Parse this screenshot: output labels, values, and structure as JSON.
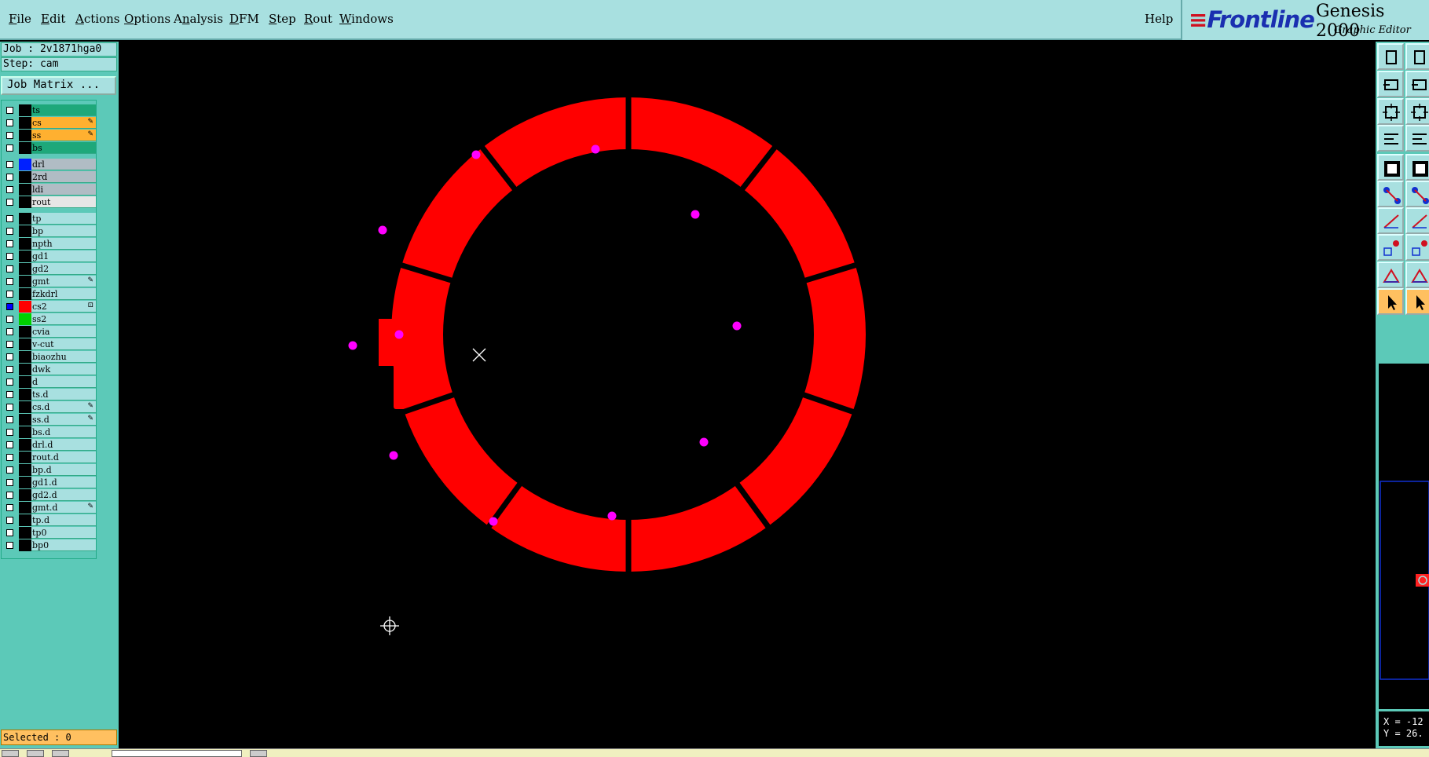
{
  "menu": {
    "items": [
      {
        "label": "File",
        "accel": "F"
      },
      {
        "label": "Edit",
        "accel": "E"
      },
      {
        "label": "Actions",
        "accel": "A"
      },
      {
        "label": "Options",
        "accel": "O"
      },
      {
        "label": "Analysis",
        "accel": "n"
      },
      {
        "label": "DFM",
        "accel": "D"
      },
      {
        "label": "Step",
        "accel": "S"
      },
      {
        "label": "Rout",
        "accel": "R"
      },
      {
        "label": "Windows",
        "accel": "W"
      }
    ],
    "help": "Help"
  },
  "brand": {
    "logo": "Frontline",
    "stripes": "≡",
    "title": "Genesis 2000",
    "subtitle": "Graphic Editor"
  },
  "job": {
    "job_text": "Job : 2v1871hga0",
    "step_text": "Step: cam",
    "matrix_button": "Job Matrix ..."
  },
  "layers": [
    {
      "name": "ts",
      "bg": "#1ea87a",
      "swatch": "#000",
      "mark": "",
      "checked": false
    },
    {
      "name": "cs",
      "bg": "#ffb030",
      "swatch": "#000",
      "mark": "✎",
      "checked": false
    },
    {
      "name": "ss",
      "bg": "#ffb030",
      "swatch": "#000",
      "mark": "✎",
      "checked": false
    },
    {
      "name": "bs",
      "bg": "#1ea87a",
      "swatch": "#000",
      "mark": "",
      "checked": false
    },
    {
      "name": "drl",
      "bg": "#b0bcc4",
      "swatch": "#0020ff",
      "mark": "",
      "checked": false
    },
    {
      "name": "2rd",
      "bg": "#b0bcc4",
      "swatch": "#000",
      "mark": "",
      "checked": false
    },
    {
      "name": "ldi",
      "bg": "#b0bcc4",
      "swatch": "#000",
      "mark": "",
      "checked": false
    },
    {
      "name": "rout",
      "bg": "#e6e6e6",
      "swatch": "#000",
      "mark": "",
      "checked": false
    },
    {
      "name": "tp",
      "bg": "#a8e0e0",
      "swatch": "#000",
      "mark": "",
      "checked": false
    },
    {
      "name": "bp",
      "bg": "#a8e0e0",
      "swatch": "#000",
      "mark": "",
      "checked": false
    },
    {
      "name": "npth",
      "bg": "#a8e0e0",
      "swatch": "#000",
      "mark": "",
      "checked": false
    },
    {
      "name": "gd1",
      "bg": "#a8e0e0",
      "swatch": "#000",
      "mark": "",
      "checked": false
    },
    {
      "name": "gd2",
      "bg": "#a8e0e0",
      "swatch": "#000",
      "mark": "",
      "checked": false
    },
    {
      "name": "gmt",
      "bg": "#a8e0e0",
      "swatch": "#000",
      "mark": "✎",
      "checked": false
    },
    {
      "name": "fzkdrl",
      "bg": "#a8e0e0",
      "swatch": "#000",
      "mark": "",
      "checked": false
    },
    {
      "name": "cs2",
      "bg": "#a8e0e0",
      "swatch": "#ff0000",
      "mark": "⊡",
      "checked": true
    },
    {
      "name": "ss2",
      "bg": "#a8e0e0",
      "swatch": "#00d000",
      "mark": "",
      "checked": false
    },
    {
      "name": "cvia",
      "bg": "#a8e0e0",
      "swatch": "#000",
      "mark": "",
      "checked": false
    },
    {
      "name": "v-cut",
      "bg": "#a8e0e0",
      "swatch": "#000",
      "mark": "",
      "checked": false
    },
    {
      "name": "biaozhu",
      "bg": "#a8e0e0",
      "swatch": "#000",
      "mark": "",
      "checked": false
    },
    {
      "name": "dwk",
      "bg": "#a8e0e0",
      "swatch": "#000",
      "mark": "",
      "checked": false
    },
    {
      "name": "d",
      "bg": "#a8e0e0",
      "swatch": "#000",
      "mark": "",
      "checked": false
    },
    {
      "name": "ts.d",
      "bg": "#a8e0e0",
      "swatch": "#000",
      "mark": "",
      "checked": false
    },
    {
      "name": "cs.d",
      "bg": "#a8e0e0",
      "swatch": "#000",
      "mark": "✎",
      "checked": false
    },
    {
      "name": "ss.d",
      "bg": "#a8e0e0",
      "swatch": "#000",
      "mark": "✎",
      "checked": false
    },
    {
      "name": "bs.d",
      "bg": "#a8e0e0",
      "swatch": "#000",
      "mark": "",
      "checked": false
    },
    {
      "name": "drl.d",
      "bg": "#a8e0e0",
      "swatch": "#000",
      "mark": "",
      "checked": false
    },
    {
      "name": "rout.d",
      "bg": "#a8e0e0",
      "swatch": "#000",
      "mark": "",
      "checked": false
    },
    {
      "name": "bp.d",
      "bg": "#a8e0e0",
      "swatch": "#000",
      "mark": "",
      "checked": false
    },
    {
      "name": "gd1.d",
      "bg": "#a8e0e0",
      "swatch": "#000",
      "mark": "",
      "checked": false
    },
    {
      "name": "gd2.d",
      "bg": "#a8e0e0",
      "swatch": "#000",
      "mark": "",
      "checked": false
    },
    {
      "name": "gmt.d",
      "bg": "#a8e0e0",
      "swatch": "#000",
      "mark": "✎",
      "checked": false
    },
    {
      "name": "tp.d",
      "bg": "#a8e0e0",
      "swatch": "#000",
      "mark": "",
      "checked": false
    },
    {
      "name": "tp0",
      "bg": "#a8e0e0",
      "swatch": "#000",
      "mark": "",
      "checked": false
    },
    {
      "name": "bp0",
      "bg": "#a8e0e0",
      "swatch": "#000",
      "mark": "",
      "checked": false
    }
  ],
  "status": {
    "selected": "Selected : 0",
    "x": "X = -12",
    "y": "Y = 26."
  },
  "colors": {
    "board": "#ff0000",
    "pad": "#ff00ff",
    "canvas_bg": "#000000"
  },
  "toolbar": {
    "buttons": [
      "open-icon",
      "window-icon",
      "import-icon",
      "frame-icon",
      "fit-icon",
      "zoom-fit-icon",
      "settings-icon",
      "grid-icon",
      "snapshot-icon",
      "measure-icon",
      "connect-icon",
      "cross-icon",
      "line-icon",
      "line2-icon",
      "pad-icon",
      "dash-icon",
      "triangle-icon",
      "arc-icon",
      "pointer-icon",
      "select-icon"
    ]
  }
}
